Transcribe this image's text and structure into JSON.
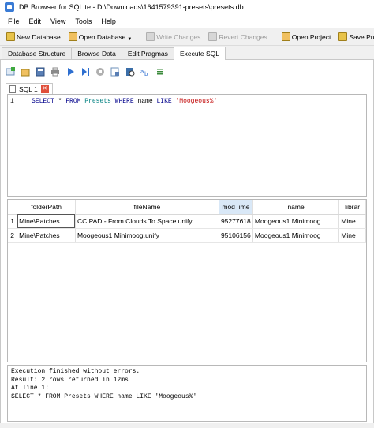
{
  "window": {
    "title": "DB Browser for SQLite - D:\\Downloads\\1641579391-presets\\presets.db"
  },
  "menu": [
    "File",
    "Edit",
    "View",
    "Tools",
    "Help"
  ],
  "toolbar": {
    "new_database": "New Database",
    "open_database": "Open Database",
    "write_changes": "Write Changes",
    "revert_changes": "Revert Changes",
    "open_project": "Open Project",
    "save_project": "Save Project"
  },
  "tabs": [
    "Database Structure",
    "Browse Data",
    "Edit Pragmas",
    "Execute SQL"
  ],
  "sql_tab": {
    "label": "SQL 1"
  },
  "editor": {
    "line_number": "1",
    "kw_select": "SELECT",
    "star": " * ",
    "kw_from": "FROM",
    "table": " Presets ",
    "kw_where": "WHERE",
    "col": " name ",
    "kw_like": "LIKE",
    "literal": " 'Moogeous%'"
  },
  "results": {
    "columns": [
      "folderPath",
      "fileName",
      "modTime",
      "name",
      "librar"
    ],
    "rows": [
      {
        "n": "1",
        "folderPath": "Mine\\Patches",
        "fileName": "CC PAD - From Clouds To Space.unify",
        "modTime": "95277618",
        "name": "Moogeous1 Minimoog",
        "librar": "Mine"
      },
      {
        "n": "2",
        "folderPath": "Mine\\Patches",
        "fileName": "Moogeous1 Minimoog.unify",
        "modTime": "95106156",
        "name": "Moogeous1 Minimoog",
        "librar": "Mine"
      }
    ]
  },
  "messages": {
    "line1": "Execution finished without errors.",
    "line2": "Result: 2 rows returned in 12ms",
    "line3": "At line 1:",
    "line4": "SELECT * FROM Presets WHERE name LIKE 'Moogeous%'"
  },
  "colors": {
    "keyword": "#00008b",
    "table_name": "#008080",
    "string_literal": "#c00000",
    "sorted_header": "#d9e8f7"
  }
}
